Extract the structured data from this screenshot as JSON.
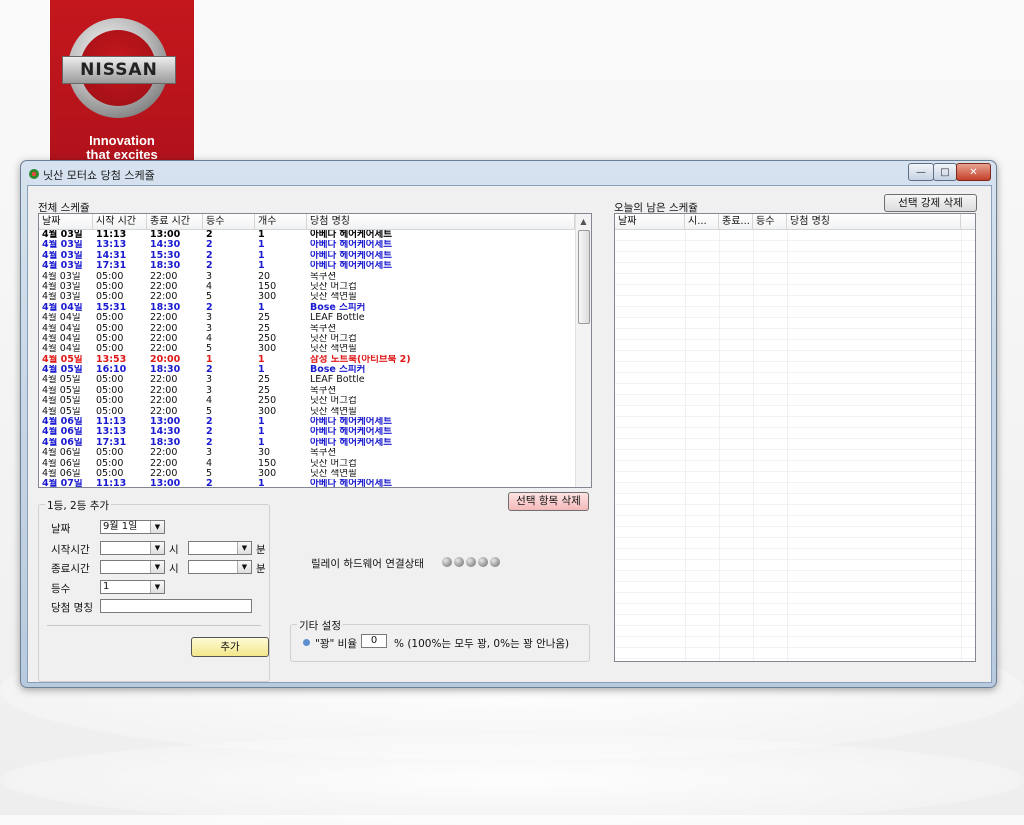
{
  "logo": {
    "brand": "NISSAN",
    "tagline_line1": "Innovation",
    "tagline_line2": "that excites"
  },
  "window": {
    "title": "닛산 모터쇼 당첨 스케쥴"
  },
  "left_panel": {
    "label": "전체 스케쥴",
    "columns": [
      "날짜",
      "시작 시간",
      "종료 시간",
      "등수",
      "개수",
      "당첨 명칭"
    ],
    "rows": [
      {
        "date": "4월 03일",
        "start": "11:13",
        "end": "13:00",
        "rank": "2",
        "count": "1",
        "prize": "아베다 헤어케어세트",
        "style": "bk"
      },
      {
        "date": "4월 03일",
        "start": "13:13",
        "end": "14:30",
        "rank": "2",
        "count": "1",
        "prize": "아베다 헤어케어세트",
        "style": "blue"
      },
      {
        "date": "4월 03일",
        "start": "14:31",
        "end": "15:30",
        "rank": "2",
        "count": "1",
        "prize": "아베다 헤어케어세트",
        "style": "blue"
      },
      {
        "date": "4월 03일",
        "start": "17:31",
        "end": "18:30",
        "rank": "2",
        "count": "1",
        "prize": "아베다 헤어케어세트",
        "style": "blue"
      },
      {
        "date": "4월 03일",
        "start": "05:00",
        "end": "22:00",
        "rank": "3",
        "count": "20",
        "prize": "목쿠션",
        "style": ""
      },
      {
        "date": "4월 03일",
        "start": "05:00",
        "end": "22:00",
        "rank": "4",
        "count": "150",
        "prize": "닛산 머그컵",
        "style": ""
      },
      {
        "date": "4월 03일",
        "start": "05:00",
        "end": "22:00",
        "rank": "5",
        "count": "300",
        "prize": "닛산 색연필",
        "style": ""
      },
      {
        "date": "4월 04일",
        "start": "15:31",
        "end": "18:30",
        "rank": "2",
        "count": "1",
        "prize": "Bose 스피커",
        "style": "blue"
      },
      {
        "date": "4월 04일",
        "start": "05:00",
        "end": "22:00",
        "rank": "3",
        "count": "25",
        "prize": "LEAF Bottle",
        "style": ""
      },
      {
        "date": "4월 04일",
        "start": "05:00",
        "end": "22:00",
        "rank": "3",
        "count": "25",
        "prize": "목쿠션",
        "style": ""
      },
      {
        "date": "4월 04일",
        "start": "05:00",
        "end": "22:00",
        "rank": "4",
        "count": "250",
        "prize": "닛산 머그컵",
        "style": ""
      },
      {
        "date": "4월 04일",
        "start": "05:00",
        "end": "22:00",
        "rank": "5",
        "count": "300",
        "prize": "닛산 색연필",
        "style": ""
      },
      {
        "date": "4월 05일",
        "start": "13:53",
        "end": "20:00",
        "rank": "1",
        "count": "1",
        "prize": "삼성 노트북(아티브북 2)",
        "style": "red"
      },
      {
        "date": "4월 05일",
        "start": "16:10",
        "end": "18:30",
        "rank": "2",
        "count": "1",
        "prize": "Bose 스피커",
        "style": "blue"
      },
      {
        "date": "4월 05일",
        "start": "05:00",
        "end": "22:00",
        "rank": "3",
        "count": "25",
        "prize": "LEAF Bottle",
        "style": ""
      },
      {
        "date": "4월 05일",
        "start": "05:00",
        "end": "22:00",
        "rank": "3",
        "count": "25",
        "prize": "목쿠션",
        "style": ""
      },
      {
        "date": "4월 05일",
        "start": "05:00",
        "end": "22:00",
        "rank": "4",
        "count": "250",
        "prize": "닛산 머그컵",
        "style": ""
      },
      {
        "date": "4월 05일",
        "start": "05:00",
        "end": "22:00",
        "rank": "5",
        "count": "300",
        "prize": "닛산 색연필",
        "style": ""
      },
      {
        "date": "4월 06일",
        "start": "11:13",
        "end": "13:00",
        "rank": "2",
        "count": "1",
        "prize": "아베다 헤어케어세트",
        "style": "blue"
      },
      {
        "date": "4월 06일",
        "start": "13:13",
        "end": "14:30",
        "rank": "2",
        "count": "1",
        "prize": "아베다 헤어케어세트",
        "style": "blue"
      },
      {
        "date": "4월 06일",
        "start": "17:31",
        "end": "18:30",
        "rank": "2",
        "count": "1",
        "prize": "아베다 헤어케어세트",
        "style": "blue"
      },
      {
        "date": "4월 06일",
        "start": "05:00",
        "end": "22:00",
        "rank": "3",
        "count": "30",
        "prize": "목쿠션",
        "style": ""
      },
      {
        "date": "4월 06일",
        "start": "05:00",
        "end": "22:00",
        "rank": "4",
        "count": "150",
        "prize": "닛산 머그컵",
        "style": ""
      },
      {
        "date": "4월 06일",
        "start": "05:00",
        "end": "22:00",
        "rank": "5",
        "count": "300",
        "prize": "닛산 색연필",
        "style": ""
      },
      {
        "date": "4월 07일",
        "start": "11:13",
        "end": "13:00",
        "rank": "2",
        "count": "1",
        "prize": "아베다 헤어케어세트",
        "style": "blue"
      }
    ],
    "delete_selected_label": "선택 항목 삭제"
  },
  "add_form": {
    "group_label": "1등, 2등 추가",
    "date_label": "날짜",
    "date_value": "9월 1일",
    "start_label": "시작시간",
    "end_label": "종료시간",
    "hour_unit": "시",
    "minute_unit": "분",
    "rank_label": "등수",
    "rank_value": "1",
    "prize_label": "당첨 명칭",
    "prize_value": "",
    "add_button": "추가"
  },
  "relay": {
    "label": "릴레이 하드웨어 연결상태"
  },
  "misc": {
    "group_label": "기타 설정",
    "ratio_prefix": "\"꽝\" 비율",
    "ratio_value": "0",
    "ratio_suffix": "% (100%는 모두 꽝, 0%는 꽝 안나옴)"
  },
  "right_panel": {
    "label": "오늘의 남은 스케쥴",
    "force_delete_label": "선택 강제 삭제",
    "columns": [
      "날짜",
      "시...",
      "종료...",
      "등수",
      "당첨 명칭"
    ]
  }
}
